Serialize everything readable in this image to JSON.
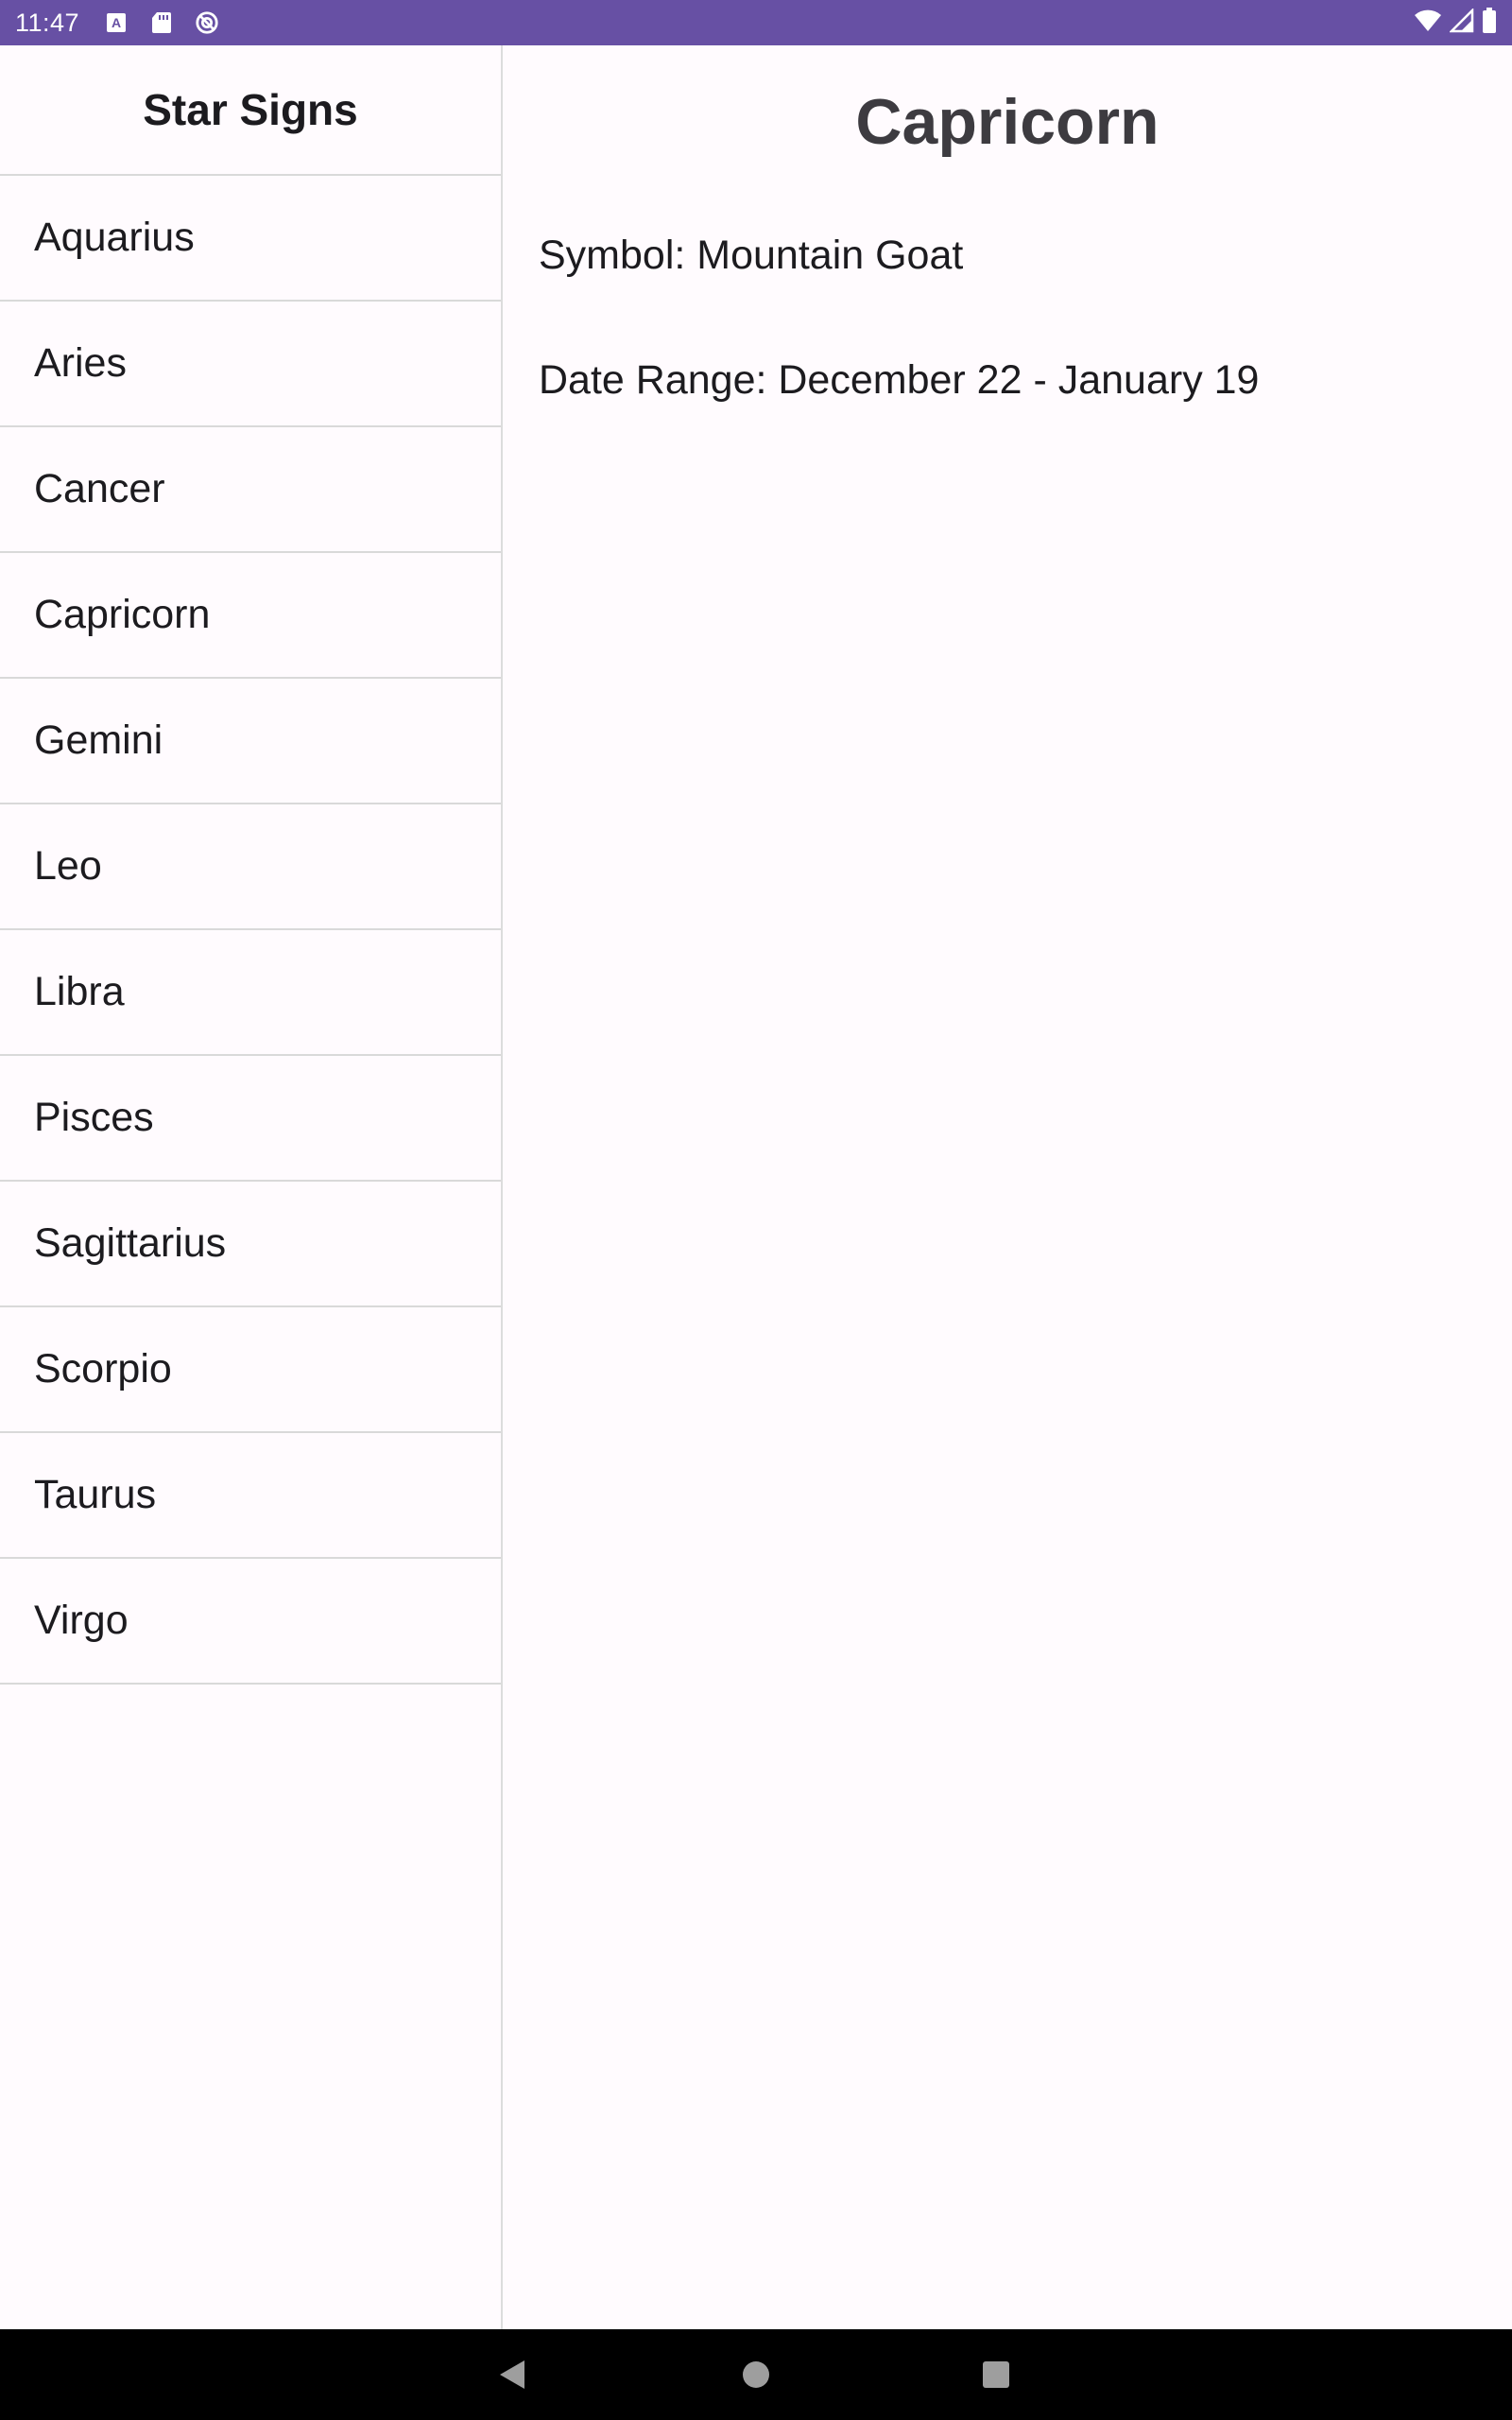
{
  "status_bar": {
    "time": "11:47",
    "left_icons": [
      "keyboard-a-icon",
      "sd-card-icon",
      "data-saver-icon"
    ],
    "right_icons": [
      "wifi-icon",
      "cell-signal-icon",
      "battery-icon"
    ],
    "background_color": "#6750a4"
  },
  "list": {
    "title": "Star Signs",
    "items": [
      {
        "label": "Aquarius"
      },
      {
        "label": "Aries"
      },
      {
        "label": "Cancer"
      },
      {
        "label": "Capricorn"
      },
      {
        "label": "Gemini"
      },
      {
        "label": "Leo"
      },
      {
        "label": "Libra"
      },
      {
        "label": "Pisces"
      },
      {
        "label": "Sagittarius"
      },
      {
        "label": "Scorpio"
      },
      {
        "label": "Taurus"
      },
      {
        "label": "Virgo"
      }
    ]
  },
  "detail": {
    "title": "Capricorn",
    "symbol": "Symbol: Mountain Goat",
    "date_range": "Date Range: December 22 - January 19"
  },
  "nav_bar": {
    "buttons": [
      "back-icon",
      "home-icon",
      "recents-icon"
    ]
  }
}
